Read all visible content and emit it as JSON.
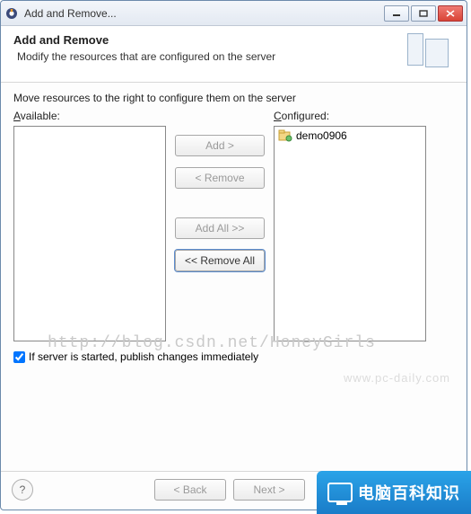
{
  "window": {
    "title": "Add and Remove..."
  },
  "header": {
    "title": "Add and Remove",
    "subtitle": "Modify the resources that are configured on the server"
  },
  "instruction": "Move resources to the right to configure them on the server",
  "available": {
    "label": "Available:",
    "items": []
  },
  "configured": {
    "label": "Configured:",
    "items": [
      {
        "name": "demo0906"
      }
    ]
  },
  "buttons": {
    "add": "Add >",
    "remove": "< Remove",
    "addAll": "Add All >>",
    "removeAll": "<< Remove All"
  },
  "checkbox": {
    "label": "If server is started, publish changes immediately",
    "checked": true
  },
  "footer": {
    "back": "< Back",
    "next": "Next >"
  },
  "watermark": "http://blog.csdn.net/HoneyGirls",
  "watermark2": "www.pc-daily.com",
  "overlay": "电脑百科知识"
}
